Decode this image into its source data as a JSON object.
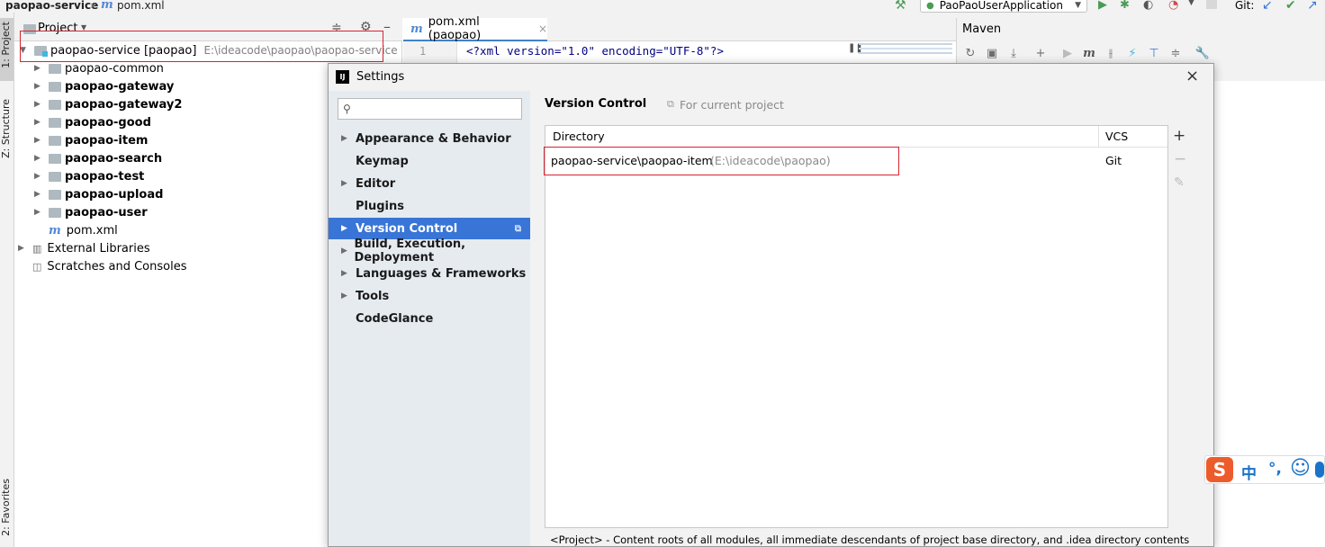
{
  "navbar": {
    "project": "paopao-service",
    "file_icon": "m",
    "file": "pom.xml",
    "run_config": "PaoPaoUserApplication",
    "git_label": "Git:"
  },
  "stripe": {
    "project_tab": "1: Project",
    "structure_tab": "Z: Structure",
    "favorites_tab": "2: Favorites"
  },
  "project_panel": {
    "title": "Project",
    "root_name": "paopao-service [paopao]",
    "root_path": "E:\\ideacode\\paopao\\paopao-service",
    "modules": [
      {
        "name": "paopao-common",
        "bold": false
      },
      {
        "name": "paopao-gateway",
        "bold": true
      },
      {
        "name": "paopao-gateway2",
        "bold": true
      },
      {
        "name": "paopao-good",
        "bold": true
      },
      {
        "name": "paopao-item",
        "bold": true
      },
      {
        "name": "paopao-search",
        "bold": true
      },
      {
        "name": "paopao-test",
        "bold": true
      },
      {
        "name": "paopao-upload",
        "bold": true
      },
      {
        "name": "paopao-user",
        "bold": true
      }
    ],
    "pom": "pom.xml",
    "external_libraries": "External Libraries",
    "scratches": "Scratches and Consoles"
  },
  "editor": {
    "tab_label": "pom.xml (paopao)",
    "line_number": "1",
    "code_line": "<?xml version=\"1.0\" encoding=\"UTF-8\"?>"
  },
  "maven": {
    "title": "Maven"
  },
  "settings": {
    "title": "Settings",
    "search_placeholder": "",
    "nav": [
      {
        "label": "Appearance & Behavior",
        "arrow": true,
        "selected": false
      },
      {
        "label": "Keymap",
        "arrow": false,
        "selected": false
      },
      {
        "label": "Editor",
        "arrow": true,
        "selected": false
      },
      {
        "label": "Plugins",
        "arrow": false,
        "selected": false
      },
      {
        "label": "Version Control",
        "arrow": true,
        "selected": true
      },
      {
        "label": "Build, Execution, Deployment",
        "arrow": true,
        "selected": false
      },
      {
        "label": "Languages & Frameworks",
        "arrow": true,
        "selected": false
      },
      {
        "label": "Tools",
        "arrow": true,
        "selected": false
      },
      {
        "label": "CodeGlance",
        "arrow": false,
        "selected": false
      }
    ],
    "page_title": "Version Control",
    "scope_hint": "For current project",
    "table": {
      "col_directory": "Directory",
      "col_vcs": "VCS",
      "rows": [
        {
          "directory": "paopao-service\\paopao-item",
          "path": "(E:\\ideacode\\paopao)",
          "vcs": "Git"
        }
      ]
    },
    "footer_note": "<Project> - Content roots of all modules, all immediate descendants of project base directory, and .idea directory contents"
  },
  "ime": {
    "logo": "S",
    "lang": "中",
    "punct": "°,",
    "emoji": "☺"
  },
  "colors": {
    "selection": "#3875d7",
    "highlight_box": "#d9232e",
    "run_green": "#499c54"
  }
}
